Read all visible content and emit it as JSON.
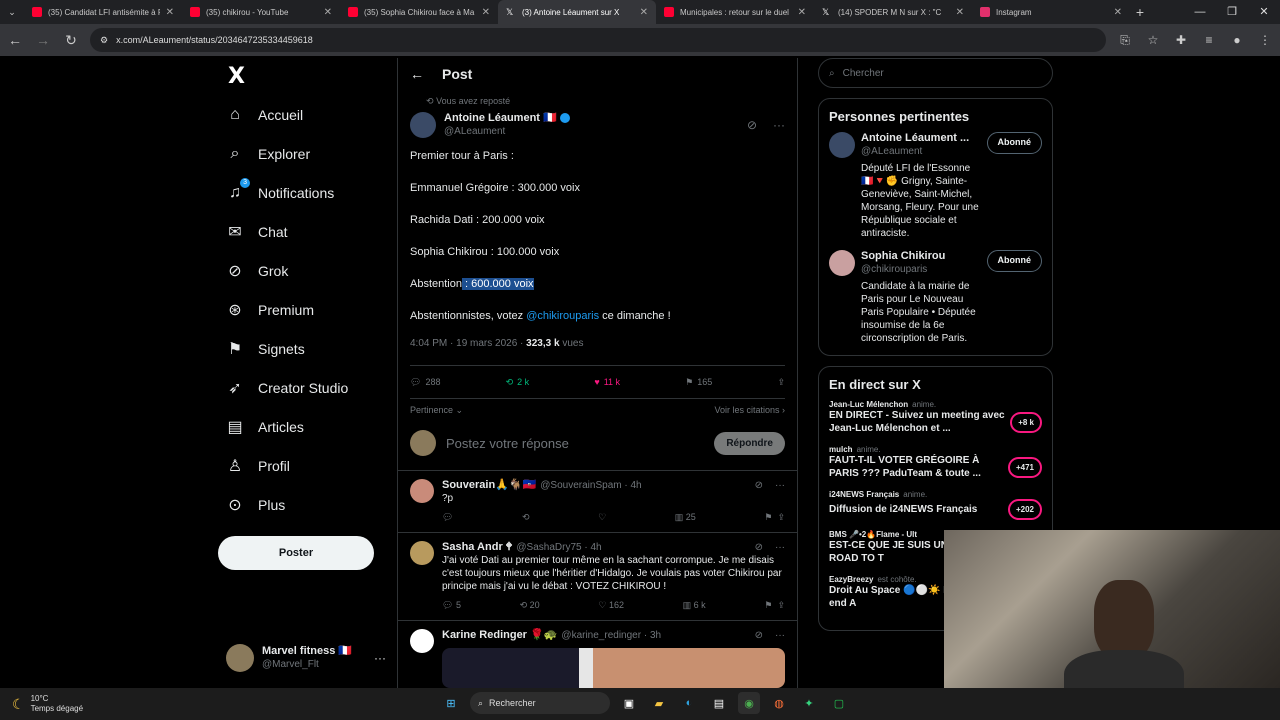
{
  "browser": {
    "tabs": [
      {
        "title": "(35) Candidat LFI antisémite à P",
        "color": "#ff0033"
      },
      {
        "title": "(35) chikirou - YouTube",
        "color": "#ff0033"
      },
      {
        "title": "(35) Sophia Chikirou face à Ma",
        "color": "#ff0033"
      },
      {
        "title": "(3) Antoine Léaument sur X",
        "color": "#000000",
        "active": true
      },
      {
        "title": "Municipales : retour sur le duel",
        "color": "#ff0033"
      },
      {
        "title": "(14) SPODER M N sur X : \"C",
        "color": "#000000"
      },
      {
        "title": "Instagram",
        "color": "#e1306c"
      }
    ],
    "url": "x.com/ALeaument/status/2034647235334459618"
  },
  "sidebar": {
    "logo": "X",
    "items": [
      {
        "label": "Accueil",
        "icon": "home-icon",
        "glyph": "⌂"
      },
      {
        "label": "Explorer",
        "icon": "search-icon",
        "glyph": "⌕"
      },
      {
        "label": "Notifications",
        "icon": "bell-icon",
        "glyph": "🔔",
        "badge": "3"
      },
      {
        "label": "Chat",
        "icon": "mail-icon",
        "glyph": "✉"
      },
      {
        "label": "Grok",
        "icon": "grok-icon",
        "glyph": "⊘"
      },
      {
        "label": "Premium",
        "icon": "premium-icon",
        "glyph": "⊛"
      },
      {
        "label": "Signets",
        "icon": "bookmark-icon",
        "glyph": "⚑"
      },
      {
        "label": "Creator Studio",
        "icon": "rocket-icon",
        "glyph": "➶"
      },
      {
        "label": "Articles",
        "icon": "article-icon",
        "glyph": "▤"
      },
      {
        "label": "Profil",
        "icon": "person-icon",
        "glyph": "♙"
      },
      {
        "label": "Plus",
        "icon": "more-icon",
        "glyph": "⊙"
      }
    ],
    "post_button": "Poster",
    "account": {
      "name": "Marvel fitness 🇫🇷",
      "handle": "@Marvel_Flt"
    }
  },
  "post": {
    "header": "Post",
    "reposted": "Vous avez reposté",
    "author": {
      "name": "Antoine Léaument 🇫🇷",
      "handle": "@ALeaument"
    },
    "lines": {
      "l1": "Premier tour à Paris :",
      "l2": "Emmanuel Grégoire : 300.000 voix",
      "l3": "Rachida Dati : 200.000 voix",
      "l4": "Sophia Chikirou : 100.000 voix",
      "l5a": "Abstention",
      "l5b": " : 600.000 voix",
      "l6a": "Abstentionnistes, votez ",
      "l6b": "@chikirouparis",
      "l6c": " ce dimanche !"
    },
    "time": "4:04 PM · 19 mars 2026 · ",
    "views": "323,3 k",
    "views_label": " vues",
    "stats": {
      "replies": "288",
      "reposts": "2 k",
      "likes": "11 k",
      "bookmarks": "165"
    },
    "sort": "Pertinence",
    "quotes": "Voir les citations",
    "reply_placeholder": "Postez votre réponse",
    "reply_button": "Répondre"
  },
  "replies": [
    {
      "name": "Souverain🙏🐐🇭🇹",
      "handle": "@SouverainSpam · 4h",
      "text": "?p",
      "stats": {
        "likes": "",
        "views": "25"
      }
    },
    {
      "name": "Sasha Andr 🕈",
      "handle": "@SashaDry75 · 4h",
      "text": "J'ai voté Dati au premier tour même en la sachant corrompue. Je me disais c'est toujours mieux que l'héritier d'Hidalgo. Je voulais pas voter Chikirou par principe mais j'ai vu le débat : VOTEZ CHIKIROU !",
      "stats": {
        "replies": "5",
        "reposts": "20",
        "likes": "162",
        "views": "6 k"
      }
    },
    {
      "name": "Karine Redinger 🌹🐢",
      "handle": "@karine_redinger · 3h"
    }
  ],
  "right": {
    "search_placeholder": "Chercher",
    "relevant_title": "Personnes pertinentes",
    "people": [
      {
        "name": "Antoine Léaument ...",
        "handle": "@ALeaument",
        "bio": "Député LFI de l'Essonne 🇫🇷🔻✊ Grigny, Sainte-Geneviève, Saint-Michel, Morsang, Fleury. Pour une République sociale et antiraciste.",
        "button": "Abonné"
      },
      {
        "name": "Sophia Chikirou",
        "handle": "@chikirouparis",
        "bio": "Candidate à la mairie de Paris pour Le Nouveau Paris Populaire • Députée insoumise de la 6e circonscription de Paris.",
        "button": "Abonné"
      }
    ],
    "live_title": "En direct sur X",
    "live": [
      {
        "who": "Jean-Luc Mélenchon",
        "role": "anime.",
        "title": "EN DIRECT - Suivez un meeting avec Jean-Luc Mélenchon et ...",
        "count": "+8 k"
      },
      {
        "who": "mulch",
        "role": "anime.",
        "title": "FAUT-T-IL VOTER GRÉGOIRE À PARIS ??? PaduTeam & toute ...",
        "count": "+471"
      },
      {
        "who": "i24NEWS Français",
        "role": "anime.",
        "title": "Diffusion de i24NEWS Français",
        "count": "+202"
      },
      {
        "who": "BMS 🎤•2🔥Flame - Ult",
        "role": "",
        "title": "EST-CE QUE JE SUIS UN GOONER OU ROAD TO T",
        "count": ""
      },
      {
        "who": "EazyBreezy",
        "role": "est cohôte.",
        "title": "Droit Au Space 🔵⚪☀️ Épisode 24 : Week-end A",
        "count": ""
      }
    ]
  },
  "taskbar": {
    "temp": "10°C",
    "weather": "Temps dégagé",
    "search": "Rechercher"
  }
}
